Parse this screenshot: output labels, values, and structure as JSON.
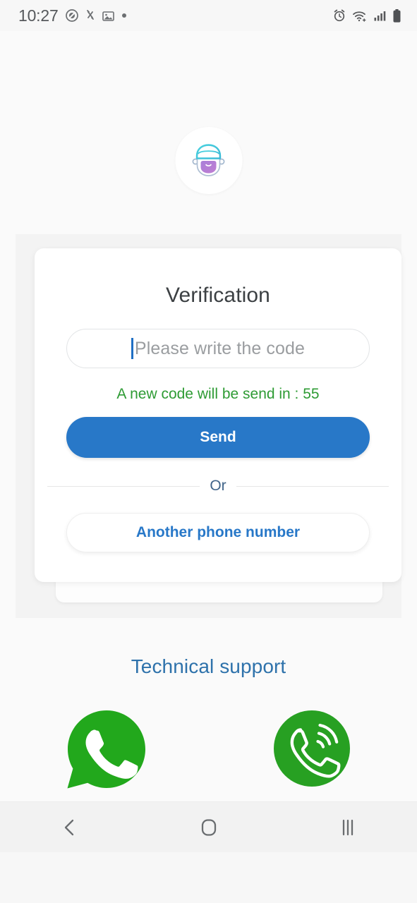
{
  "status_bar": {
    "time": "10:27",
    "left_icons": [
      "do-not-disturb-icon",
      "bluetooth-transfer-icon",
      "image-icon",
      "dot-icon"
    ],
    "right_icons": [
      "alarm-icon",
      "wifi-icon",
      "cellular-signal-icon",
      "battery-icon"
    ]
  },
  "avatar": {
    "icon": "bearded-face-avatar-icon",
    "hat_color": "#3fc8d8",
    "beard_color": "#b07ad6"
  },
  "card": {
    "title": "Verification",
    "code_input": {
      "value": "",
      "placeholder": "Please write the code",
      "caret_color": "#1f6fc4"
    },
    "countdown_text": "A new code will be send in : 55",
    "countdown_color": "#2e9b34",
    "send_label": "Send",
    "send_color": "#2878c8",
    "divider_text": "Or",
    "another_number_label": "Another phone number",
    "another_number_color": "#2878c8"
  },
  "support": {
    "title": "Technical support",
    "title_color": "#2e72ab",
    "items": [
      {
        "label": "WhatsApp",
        "icon": "whatsapp-icon",
        "color": "#2aa81a"
      },
      {
        "label": "Call",
        "icon": "phone-call-icon",
        "color": "#27a022"
      }
    ]
  },
  "nav_bar": {
    "back": "back-chevron-icon",
    "home": "home-squircle-icon",
    "recents": "recents-bars-icon"
  }
}
